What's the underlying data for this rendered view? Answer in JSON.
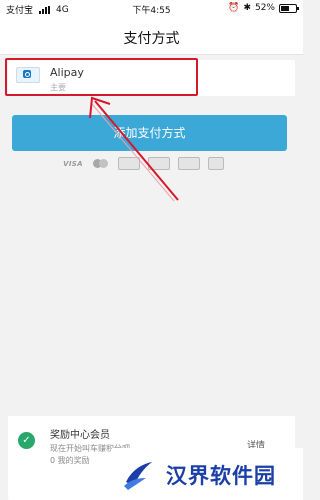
{
  "status_bar": {
    "carrier": "支付宝",
    "network": "4G",
    "time": "下午4:55",
    "battery": "52%",
    "battery_level": 0.52
  },
  "header": {
    "title": "支付方式"
  },
  "payment_method": {
    "name": "Alipay",
    "subtitle": "主要",
    "icon": "alipay-icon"
  },
  "add_button": {
    "label": "添加支付方式"
  },
  "card_logos": [
    "VISA",
    "mastercard-icon",
    "maestro-icon",
    "american-express-icon",
    "discover-icon",
    "jcb-icon"
  ],
  "rewards": {
    "title": "奖励中心会员",
    "line2": "现在开始叫车赚积分吧",
    "line3": "0 我的奖励",
    "details": "详情"
  },
  "watermark": {
    "text": "汉界软件园"
  },
  "colors": {
    "accent": "#3ba8d8",
    "annotation": "#d7182a",
    "rewards_badge": "#28a86b"
  }
}
